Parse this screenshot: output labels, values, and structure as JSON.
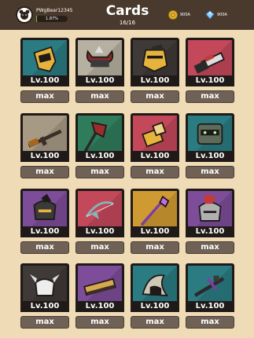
{
  "header": {
    "title": "Cards",
    "count": "16/16",
    "player_name": "PWgBear12345",
    "xp_percent": "1.87%",
    "xp_fraction": 0.0187,
    "gold": "900A",
    "gems": "900A"
  },
  "cards": [
    {
      "level": "Lv.100",
      "button": "max",
      "bg": "#2b7c82",
      "icon": "helmet-gold-icon"
    },
    {
      "level": "Lv.100",
      "button": "max",
      "bg": "#b6b0a0",
      "icon": "horned-helmet-icon"
    },
    {
      "level": "Lv.100",
      "button": "max",
      "bg": "#3f3a37",
      "icon": "knight-helmet-icon"
    },
    {
      "level": "Lv.100",
      "button": "max",
      "bg": "#c3485a",
      "icon": "chainsaw-icon"
    },
    {
      "level": "Lv.100",
      "button": "max",
      "bg": "#a79a84",
      "icon": "rifle-icon"
    },
    {
      "level": "Lv.100",
      "button": "max",
      "bg": "#2f7c5b",
      "icon": "axe-icon"
    },
    {
      "level": "Lv.100",
      "button": "max",
      "bg": "#c3485a",
      "icon": "gauntlet-icon"
    },
    {
      "level": "Lv.100",
      "button": "max",
      "bg": "#2b7c82",
      "icon": "robot-helmet-icon"
    },
    {
      "level": "Lv.100",
      "button": "max",
      "bg": "#7d4d99",
      "icon": "feather-helmet-icon"
    },
    {
      "level": "Lv.100",
      "button": "max",
      "bg": "#c3485a",
      "icon": "bow-icon"
    },
    {
      "level": "Lv.100",
      "button": "max",
      "bg": "#d09a32",
      "icon": "magic-staff-icon"
    },
    {
      "level": "Lv.100",
      "button": "max",
      "bg": "#7d4d99",
      "icon": "plumed-helmet-icon"
    },
    {
      "level": "Lv.100",
      "button": "max",
      "bg": "#3f3a37",
      "icon": "viking-helmet-icon"
    },
    {
      "level": "Lv.100",
      "button": "max",
      "bg": "#7d4d99",
      "icon": "golden-blade-icon"
    },
    {
      "level": "Lv.100",
      "button": "max",
      "bg": "#2b7c82",
      "icon": "hood-icon"
    },
    {
      "level": "Lv.100",
      "button": "max",
      "bg": "#2b7c82",
      "icon": "crossbow-icon"
    }
  ]
}
